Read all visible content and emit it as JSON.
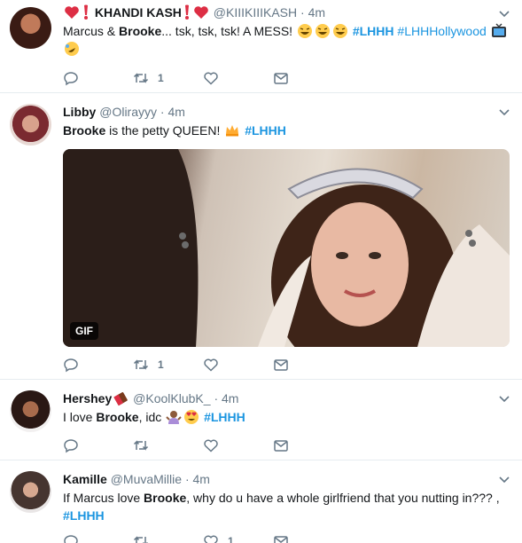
{
  "tweets": [
    {
      "name": "KHANDI KASH",
      "handle": "@KIIIKIIIKASH",
      "time": "4m",
      "text_pre": "Marcus & ",
      "text_bold": "Brooke",
      "text_post": "... tsk, tsk, tsk! A MESS! ",
      "hashtag1": "#LHHH",
      "hashtag2": "#LHHHollywood",
      "retweets": "1",
      "likes": ""
    },
    {
      "name": "Libby",
      "handle": "@Olirayyy",
      "time": "4m",
      "text_bold": "Brooke",
      "text_post": " is the petty QUEEN! ",
      "hashtag1": "#LHHH",
      "gif_label": "GIF",
      "retweets": "1",
      "likes": ""
    },
    {
      "name": "Hershey",
      "handle": "@KoolKlubK_",
      "time": "4m",
      "text_pre": "I love ",
      "text_bold": "Brooke",
      "text_post": ", idc ",
      "hashtag1": "#LHHH",
      "retweets": "",
      "likes": ""
    },
    {
      "name": "Kamille",
      "handle": "@MuvaMillie",
      "time": "4m",
      "text_pre": "If Marcus love ",
      "text_bold": "Brooke",
      "text_post": ", why do u have a whole girlfriend that you nutting in??? ,",
      "hashtag1": "#LHHH",
      "retweets": "",
      "likes": "1"
    }
  ],
  "icons": {
    "reply": "reply-icon",
    "retweet": "retweet-icon",
    "like": "heart-icon",
    "dm": "envelope-icon",
    "more": "chevron-down-icon"
  },
  "colors": {
    "link": "#1b95e0",
    "muted": "#657786",
    "text": "#14171a"
  }
}
